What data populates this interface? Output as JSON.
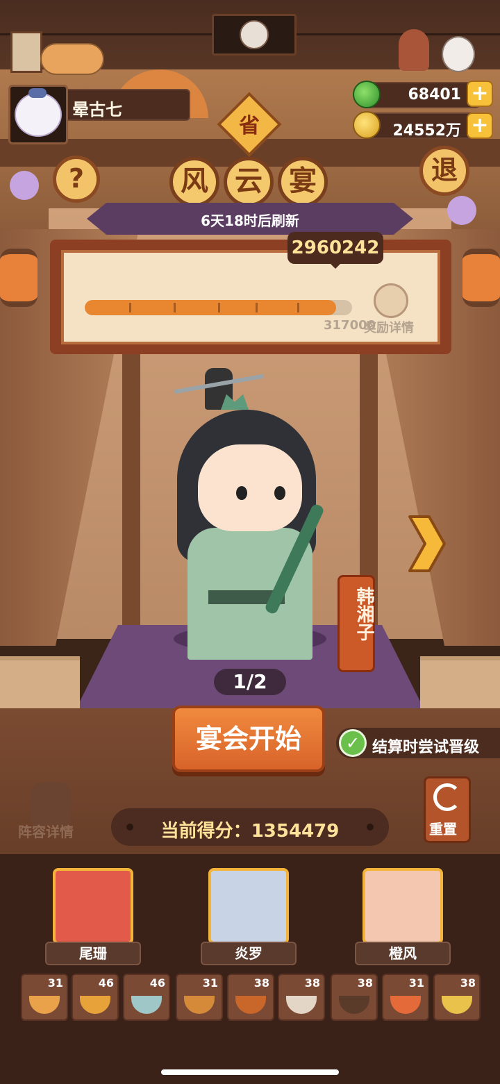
{
  "player": {
    "name": "晕古七"
  },
  "currency": {
    "jade": "68401",
    "coins": "24552万"
  },
  "event": {
    "badge": "省",
    "title_chars": [
      "风",
      "云",
      "宴"
    ],
    "refresh": "6天18时后刷新",
    "help_icon": "?",
    "exit_label": "退"
  },
  "progress": {
    "current": "2960242",
    "goal_label": "317000",
    "reward_label": "奖励详情",
    "current_value": 2960242,
    "goal_value": 3170000,
    "fraction": 0.94
  },
  "character": {
    "name": "韩湘子",
    "page": "1/2"
  },
  "actions": {
    "start": "宴会开始",
    "upgrade": "结算时尝试晋级",
    "upgrade_checked": "✓",
    "lineup": "阵容详情",
    "reset": "重置"
  },
  "score": {
    "label": "当前得分：",
    "value": "1354479"
  },
  "heroes": [
    {
      "name": "尾珊",
      "color": "#e25a4a"
    },
    {
      "name": "炎罗",
      "color": "#c8d4e6"
    },
    {
      "name": "橙风",
      "color": "#f4c8b0"
    }
  ],
  "dishes": [
    {
      "level": "31",
      "color": "#e9a24a"
    },
    {
      "level": "46",
      "color": "#e8a23a"
    },
    {
      "level": "46",
      "color": "#9fc7c8"
    },
    {
      "level": "31",
      "color": "#d58a3a"
    },
    {
      "level": "38",
      "color": "#c9662a"
    },
    {
      "level": "38",
      "color": "#e4d6c6"
    },
    {
      "level": "38",
      "color": "#5a3a28"
    },
    {
      "level": "31",
      "color": "#e46a3a"
    },
    {
      "level": "38",
      "color": "#e8c24a"
    }
  ]
}
